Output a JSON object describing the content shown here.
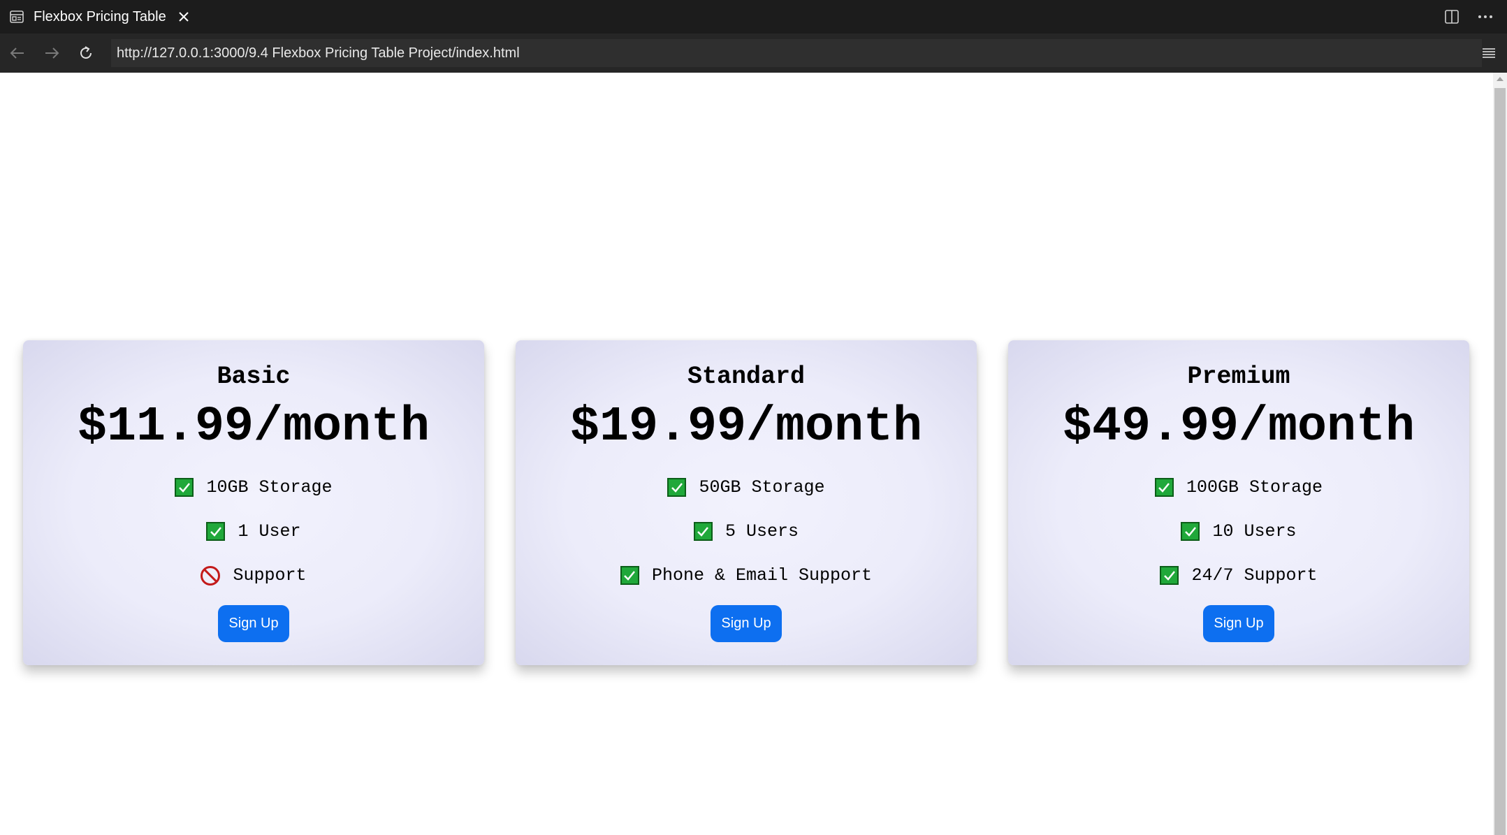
{
  "browser": {
    "tab_title": "Flexbox Pricing Table",
    "url": "http://127.0.0.1:3000/9.4 Flexbox Pricing Table Project/index.html",
    "icons": {
      "tab": "page-icon",
      "close": "close-icon",
      "split": "split-view-icon",
      "more": "more-icon",
      "back": "back-arrow-icon",
      "forward": "forward-arrow-icon",
      "reload": "reload-icon",
      "menu": "menu-icon"
    }
  },
  "plans": [
    {
      "name": "Basic",
      "price": "$11.99/month",
      "features": [
        {
          "text": "10GB Storage",
          "included": true
        },
        {
          "text": "1 User",
          "included": true
        },
        {
          "text": "Support",
          "included": false
        }
      ],
      "button": "Sign Up"
    },
    {
      "name": "Standard",
      "price": "$19.99/month",
      "features": [
        {
          "text": "50GB Storage",
          "included": true
        },
        {
          "text": "5 Users",
          "included": true
        },
        {
          "text": "Phone & Email Support",
          "included": true
        }
      ],
      "button": "Sign Up"
    },
    {
      "name": "Premium",
      "price": "$49.99/month",
      "features": [
        {
          "text": "100GB Storage",
          "included": true
        },
        {
          "text": "10 Users",
          "included": true
        },
        {
          "text": "24/7 Support",
          "included": true
        }
      ],
      "button": "Sign Up"
    }
  ],
  "colors": {
    "button": "#0d6ff0",
    "check": "#20a83a",
    "prohibited": "#c31a1a",
    "card": "#ececfa"
  }
}
